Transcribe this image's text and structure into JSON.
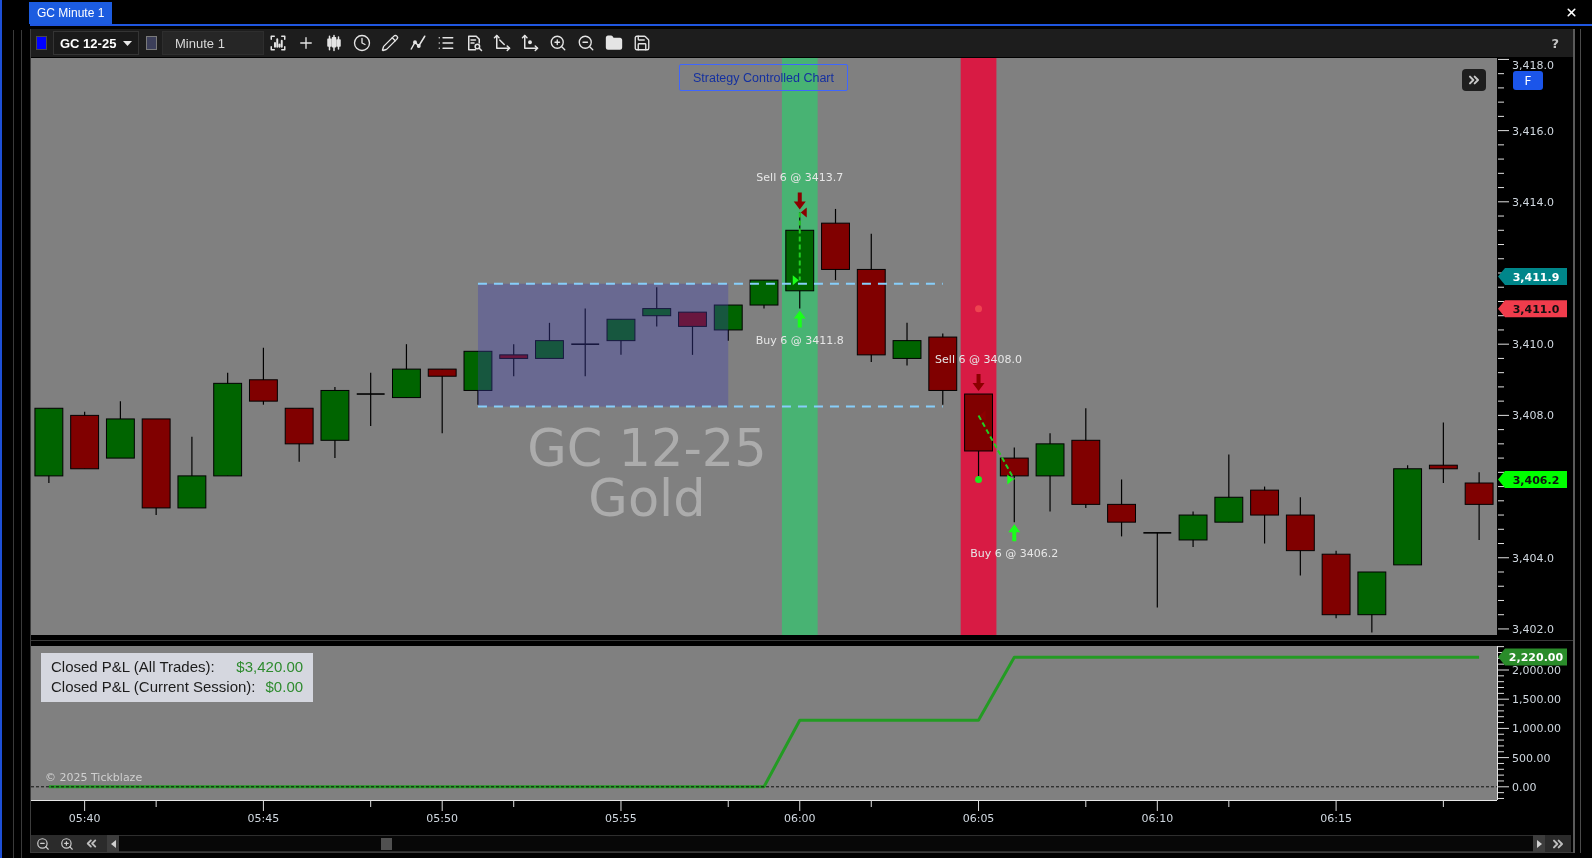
{
  "window": {
    "title": "GC Minute 1"
  },
  "toolbar": {
    "symbol": "GC 12-25",
    "interval": "Minute 1",
    "help": "?"
  },
  "price_pane": {
    "strategy_label": "Strategy Controlled Chart",
    "axis_button": "F",
    "watermark": [
      "GC 12-25",
      "Gold"
    ],
    "axis_labels": [
      "3,418.0",
      "3,416.0",
      "3,414.0",
      "3,410.0",
      "3,408.0",
      "3,404.0",
      "3,402.0"
    ],
    "highlight_bands": [
      {
        "color": "#48b373"
      },
      {
        "color": "#d81b44"
      }
    ],
    "trade_markers": [
      {
        "kind": "sell",
        "text": "Sell 6 @ 3413.7"
      },
      {
        "kind": "buy",
        "text": "Buy 6 @ 3411.8"
      },
      {
        "kind": "sell",
        "text": "Sell 6 @ 3408.0"
      },
      {
        "kind": "buy",
        "text": "Buy 6 @ 3406.2"
      }
    ],
    "dots": [
      {
        "color": "#ee4450"
      },
      {
        "color": "#1fe81f"
      }
    ],
    "price_tags": [
      {
        "text": "3,411.9",
        "color": "#00868a"
      },
      {
        "text": "3,411.0",
        "color": "#f03c4c"
      },
      {
        "text": "3,406.2",
        "color": "#00ff00"
      }
    ]
  },
  "pnl_pane": {
    "summary": [
      {
        "label": "Closed P&L (All Trades):",
        "value": "$3,420.00"
      },
      {
        "label": "Closed P&L (Current Session):",
        "value": "$0.00"
      }
    ],
    "copyright": "© 2025 Tickblaze",
    "price_tags": [
      {
        "text": "2,220.00",
        "color": "#2a8c2a"
      }
    ],
    "chart_data": {
      "type": "line",
      "categories": [
        null,
        "05:40",
        null,
        null,
        null,
        null,
        "05:45",
        null,
        null,
        null,
        null,
        "05:50",
        null,
        null,
        null,
        null,
        "05:55",
        null,
        null,
        null,
        null,
        "06:00",
        null,
        null,
        null,
        null,
        "06:05",
        null,
        null,
        null,
        null,
        "06:10",
        null,
        null,
        null,
        null,
        "06:15",
        null,
        null,
        null,
        null
      ],
      "series": [
        {
          "values": [
            0,
            0,
            0,
            0,
            0,
            0,
            0,
            0,
            0,
            0,
            0,
            0,
            0,
            0,
            0,
            0,
            0,
            0,
            0,
            0,
            0,
            1140,
            1140,
            1140,
            1140,
            1140,
            1140,
            2220,
            2220,
            2220,
            2220,
            2220,
            2220,
            2220,
            2220,
            2220,
            2220,
            2220,
            2220,
            2220,
            2220
          ]
        }
      ],
      "ylim": [
        -226,
        2411
      ],
      "yticks": [
        {
          "value": 0,
          "label": "0.00"
        },
        {
          "value": 500,
          "label": "500.00"
        },
        {
          "value": 1000,
          "label": "1,000.00"
        },
        {
          "value": 1500,
          "label": "1,500.00"
        },
        {
          "value": 2000,
          "label": "2,000.00"
        }
      ]
    }
  }
}
